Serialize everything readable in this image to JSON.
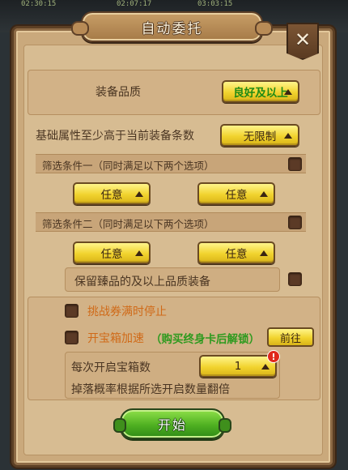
{
  "background": {
    "timestamps": [
      "02:30:15",
      "02:07:17",
      "03:03:15"
    ]
  },
  "dialog": {
    "title": "自动委托",
    "close_symbol": "✕"
  },
  "equipment": {
    "quality_label": "装备品质",
    "quality_value": "良好及以上",
    "base_attr_label": "基础属性至少高于当前装备条数",
    "base_attr_value": "无限制"
  },
  "filter1": {
    "label": "筛选条件一（同时满足以下两个选项）",
    "option_a": "任意",
    "option_b": "任意"
  },
  "filter2": {
    "label": "筛选条件二（同时满足以下两个选项）",
    "option_a": "任意",
    "option_b": "任意",
    "keep_label": "保留臻品的及以上品质装备"
  },
  "options": {
    "stop_label": "挑战券满时停止",
    "chest_speed_label": "开宝箱加速",
    "unlock_hint": "（购买终身卡后解锁）",
    "goto_label": "前往",
    "chests_label": "每次开启宝箱数",
    "chests_value": "1",
    "alert_symbol": "!",
    "drop_note": "掉落概率根据所选开启数量翻倍"
  },
  "actions": {
    "start_label": "开始"
  },
  "colors": {
    "panel": "#caa97c",
    "dropdown": "#f1d32e",
    "quality_text": "#1f8a16",
    "orange_text": "#d06a18",
    "start_button": "#4fb021",
    "alert": "#e0281c"
  }
}
